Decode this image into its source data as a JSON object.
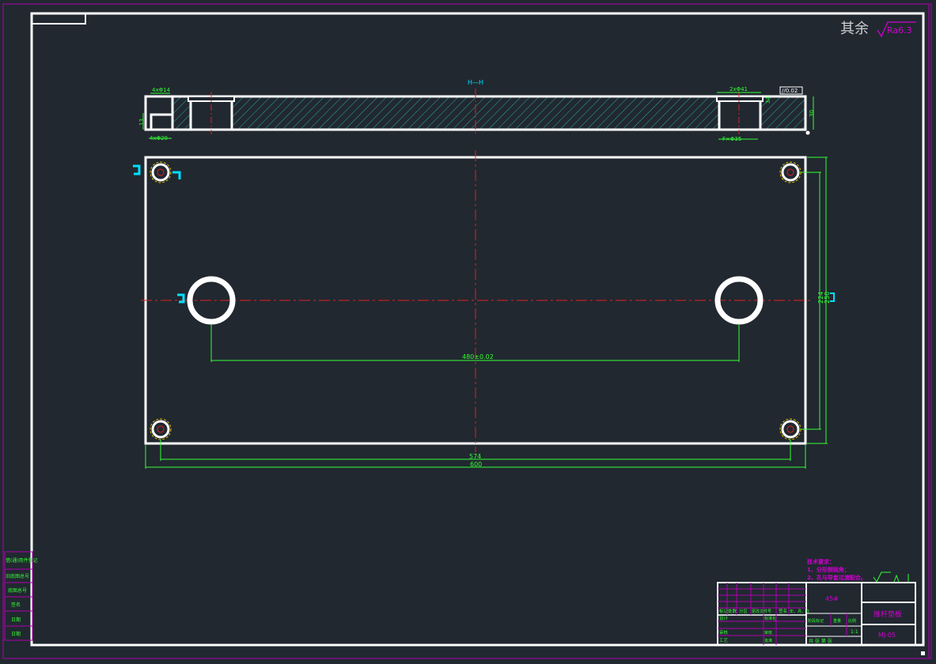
{
  "roughness_note": {
    "prefix": "其余",
    "symbol": "Ra6.3"
  },
  "section_view": {
    "left_hole_top": "4xΦ14",
    "left_hole_bottom": "4xΦ20",
    "left_side_dim": "13",
    "right_hole_top": "2xΦ41",
    "right_hole_bottom": "F×Φ35",
    "right_hole_depth": "34",
    "thickness": "30",
    "flatness_frame": "//0.02",
    "section_marker": "H—H"
  },
  "plan_view": {
    "center_distance": "480±0.02",
    "hole_spacing_x": "574",
    "overall_length": "600",
    "hole_spacing_y": "224",
    "overall_width": "250"
  },
  "tech_requirements": {
    "title": "技术要求：",
    "lines": [
      "1、分形倒钝角；",
      "2、孔与导套过渡配合。"
    ]
  },
  "left_margin_labels": [
    "借(通)用件登记",
    "旧底图总号",
    "底图总号",
    "签名",
    "日期",
    "日期"
  ],
  "title_block": {
    "material": "45#",
    "part_name": "推杆垫板",
    "drawing_no": "MJ-05",
    "header_cells": [
      "标记",
      "处数",
      "分区",
      "更改文件号",
      "签名",
      "年、月、日"
    ],
    "sign_rows": [
      "设计",
      "审核",
      "工艺"
    ],
    "sign_mid": [
      "标准化",
      "审核",
      "批准"
    ],
    "stage_cells": [
      "阶段标记",
      "重量",
      "比例"
    ],
    "sheet_text": "共 张 第 张",
    "scale": "1:1"
  }
}
